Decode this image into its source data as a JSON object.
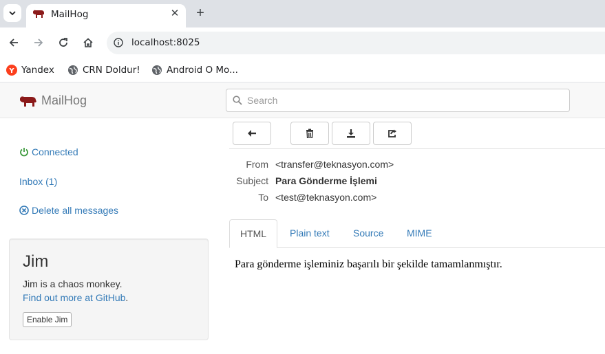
{
  "browser": {
    "tab_title": "MailHog",
    "url": "localhost:8025",
    "bookmarks": [
      "Yandex",
      "CRN Doldur!",
      "Android O Mo..."
    ]
  },
  "app": {
    "brand": "MailHog",
    "search_placeholder": "Search"
  },
  "sidebar": {
    "connected": "Connected",
    "inbox": "Inbox (1)",
    "delete_all": "Delete all messages"
  },
  "jim": {
    "title": "Jim",
    "description": "Jim is a chaos monkey.",
    "link_text": "Find out more at GitHub",
    "link_suffix": ".",
    "button": "Enable Jim"
  },
  "message": {
    "from_label": "From",
    "from": "<transfer@teknasyon.com>",
    "subject_label": "Subject",
    "subject": "Para Gönderme İşlemi",
    "to_label": "To",
    "to": "<test@teknasyon.com>",
    "tabs": [
      "HTML",
      "Plain text",
      "Source",
      "MIME"
    ],
    "body": "Para gönderme işleminiz başarılı bir şekilde tamamlanmıştır."
  },
  "colors": {
    "link": "#337ab7",
    "brand_icon": "#8b1a1a",
    "connected": "#3c9a3c"
  }
}
